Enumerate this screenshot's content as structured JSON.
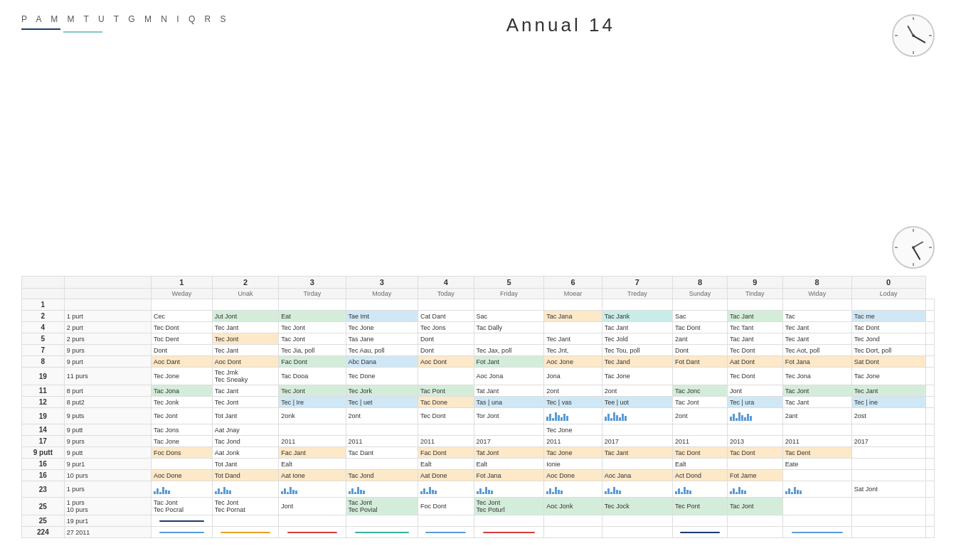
{
  "header": {
    "nav_letters": "P  A  M  M  T  U  T  G  M  N  I  Q  R  S",
    "title": "Annual 14",
    "underline_colors": [
      "#1a3a6b",
      "#7fc8c8"
    ]
  },
  "column_numbers": [
    "",
    "",
    "1",
    "2",
    "3",
    "3",
    "4",
    "5",
    "6",
    "7",
    "8",
    "9",
    "8",
    "0"
  ],
  "column_days": [
    "",
    "",
    "Weday",
    "Unak",
    "Tirday",
    "Moday",
    "Today",
    "Friday",
    "Moear",
    "Treday",
    "Sunday",
    "Tinday",
    "Widay",
    "Loday"
  ],
  "rows": [
    {
      "id": "1",
      "label": "1",
      "col1": "",
      "cells": [
        "",
        "",
        "",
        "",
        "",
        "",
        "",
        "",
        "",
        "",
        "",
        ""
      ]
    },
    {
      "id": "2",
      "label": "2",
      "col1": "1 purt",
      "cells": [
        "Cec",
        "Jut Jont",
        "Eat",
        "Tae Imt",
        "Cat Dant",
        "Sac",
        "Tac Jana",
        "Tac Jank",
        "Sac",
        "Tac Jant",
        "Tac",
        "Tac me"
      ]
    },
    {
      "id": "4",
      "label": "4",
      "col1": "2 purt",
      "cells": [
        "Tec Dont",
        "Tec Jant",
        "Tec Jont",
        "Tec Jone",
        "Tec Jons",
        "Tac Dally",
        "",
        "Tac Jant",
        "Tac Dont",
        "Tec Tant",
        "Tec Jant",
        "Tac Dont"
      ]
    },
    {
      "id": "5",
      "label": "5",
      "col1": "2 purs",
      "cells": [
        "Toc Dent",
        "Tec Jont",
        "Tac Jont",
        "Tas Jane",
        "Dont",
        "",
        "Tec Jant",
        "Tec Jold",
        "2ant",
        "Tac Jant",
        "Tec Jant",
        "Tec Jond"
      ]
    },
    {
      "id": "7",
      "label": "7",
      "col1": "9 purs",
      "cells": [
        "Dont",
        "Tec Jant",
        "Tec Jia, poll",
        "Tec Aau, poll",
        "Dont",
        "Tec Jax, poll",
        "Tec Jnt,",
        "Tec Tou, poll",
        "Dont",
        "Tec Dont",
        "Tec Aot, poll",
        "Tec Dort, poll"
      ]
    },
    {
      "id": "8",
      "label": "8",
      "col1": "9 purt",
      "cells": [
        "Aoc Dant",
        "Aoc Dont",
        "Fac Dont",
        "Abc Dana",
        "Aoc Dont",
        "Fot Jant",
        "Aoc Jone",
        "Tec Jand",
        "Fot Dant",
        "Aat Dont",
        "Fot Jana",
        "Sat Dont"
      ]
    },
    {
      "id": "19",
      "label": "19",
      "col1": "11 purs",
      "cells": [
        "Tec Jone",
        "Tec Jmk\nTec Sneaky",
        "Tac Dooa",
        "Tec Done",
        "",
        "Aoc Jona",
        "Jona",
        "Tac Jone",
        "",
        "Tec Dont",
        "Tec Jona",
        "Tac Jone"
      ]
    },
    {
      "id": "11",
      "label": "11",
      "col1": "8 purt",
      "cells": [
        "Tac Jona",
        "Tac Jant",
        "Tec Jont",
        "Tec Jork",
        "Tac Pont",
        "Tat Jant",
        "2ont",
        "2ont",
        "Tac Jonc",
        "Jont",
        "Tac Jont",
        "Tec Jant"
      ]
    },
    {
      "id": "12",
      "label": "12",
      "col1": "8 put2",
      "cells": [
        "Tec Jonk",
        "Tec Jont",
        "Tec | Ire",
        "Tec | uet",
        "Tac Done",
        "Tas | una",
        "Tec | vas",
        "Tee | uot",
        "Tac Jont",
        "Tec | ura",
        "Tac Jant",
        "Tec | ine"
      ]
    },
    {
      "id": "19b",
      "label": "19",
      "col1": "9 puts",
      "cells": [
        "Tec Jont",
        "Tot Jant",
        "2onk",
        "2ont",
        "Tec Dont",
        "Tor Jont",
        "BARS1",
        "BARS2",
        "2ont",
        "BARS3",
        "2ant",
        "2ost"
      ]
    },
    {
      "id": "14",
      "label": "14",
      "col1": "9 putt",
      "cells": [
        "Tac Jons",
        "Aat Jnay",
        "",
        "",
        "",
        "",
        "Tec Jone",
        "",
        "",
        "",
        "",
        ""
      ]
    },
    {
      "id": "17",
      "label": "17",
      "col1": "9 purs",
      "cells": [
        "Tac Jone",
        "Tac Jond",
        "2011",
        "2011",
        "2011",
        "2017",
        "2011",
        "2017",
        "2011",
        "2013",
        "2011",
        "2017"
      ]
    },
    {
      "id": "9",
      "label": "9 putt",
      "col1": "9 putt",
      "cells": [
        "Foc Dons",
        "Aat Jonk",
        "Fac Jant",
        "Tac Dant",
        "Fac Dont",
        "Tat Jont",
        "Tac Jone",
        "Tac Jant",
        "Tac Dont",
        "Tac Dont",
        "Tac Dent",
        ""
      ]
    },
    {
      "id": "16a",
      "label": "16",
      "col1": "9 pur1",
      "cells": [
        "",
        "Tot Jant",
        "Ealt",
        "",
        "Ealt",
        "Ealt",
        "Ionie",
        "",
        "Ealt",
        "",
        "Eate",
        ""
      ]
    },
    {
      "id": "16b",
      "label": "16",
      "col1": "10 purs",
      "cells": [
        "Aoc Done",
        "Tot Dand",
        "Aat Ione",
        "Tac Jond",
        "Aat Done",
        "Fot Jana",
        "Aoc Done",
        "Aoc Jana",
        "Act Dond",
        "Fot Jame",
        "",
        ""
      ]
    },
    {
      "id": "23",
      "label": "23",
      "col1": "1 purs",
      "cells": [
        "BARS_SM1",
        "BARS_SM2",
        "BARS_SM3",
        "BARS_SM4",
        "BARS_SM5",
        "BARS_SM6",
        "BARS_SM7",
        "BARS_SM8",
        "BARS_SM9",
        "BARS_SM10",
        "BARS_SM11",
        "Sat Jont"
      ]
    },
    {
      "id": "25",
      "label": "25",
      "col1": "1 purs\n10 purs",
      "cells": [
        "Tac Jont\nTec Pocral",
        "Tec Jont\nTec Pornat",
        "Jont",
        "Tac Jont\nTec Povial",
        "Foc Dont",
        "Tec Jont\nTec Poturl",
        "Aoc Jonk",
        "Tec Jock",
        "Tec Pont",
        "Tac Jont",
        "",
        ""
      ]
    },
    {
      "id": "25b",
      "label": "25",
      "col1": "19 pur1",
      "cells": [
        "LINE_BLUE",
        "",
        "",
        "",
        "",
        "",
        "",
        "",
        "",
        "",
        "",
        ""
      ]
    },
    {
      "id": "224",
      "label": "224",
      "col1": "27 2011",
      "cells": [
        "LINE_BLUE2",
        "LINE_ORANGE",
        "LINE_RED",
        "LINE_TEAL",
        "LINE_BLUE3",
        "LINE_RED2",
        "",
        "",
        "LINE_BLUE4",
        "",
        "LINE_BLUE5",
        ""
      ]
    }
  ],
  "row_colors": {
    "2": [
      "",
      "green",
      "green",
      "blue",
      "",
      "",
      "orange",
      "teal",
      "",
      "green",
      "",
      "blue"
    ],
    "4": [
      "",
      "",
      "",
      "",
      "",
      "",
      "",
      "",
      "",
      "",
      "",
      ""
    ],
    "5": [
      "",
      "orange",
      "",
      "",
      "",
      "",
      "",
      "",
      "",
      "",
      "",
      ""
    ],
    "8": [
      "orange",
      "orange",
      "orange",
      "orange",
      "orange",
      "orange",
      "orange",
      "orange",
      "orange",
      "orange",
      "orange",
      "orange"
    ],
    "11": [
      "green",
      "",
      "green",
      "green",
      "green",
      "",
      "",
      "",
      "green",
      "",
      "green",
      "green"
    ],
    "12": [
      "",
      "",
      "blue",
      "blue",
      "orange",
      "blue",
      "blue",
      "blue",
      "",
      "blue",
      "",
      "blue"
    ],
    "16b": [
      "orange",
      "orange",
      "orange",
      "orange",
      "orange",
      "orange",
      "orange",
      "orange",
      "orange",
      "orange",
      "",
      ""
    ],
    "25": [
      "",
      "",
      "",
      "green",
      "",
      "green",
      "green",
      "green",
      "green",
      "green",
      "",
      ""
    ]
  }
}
